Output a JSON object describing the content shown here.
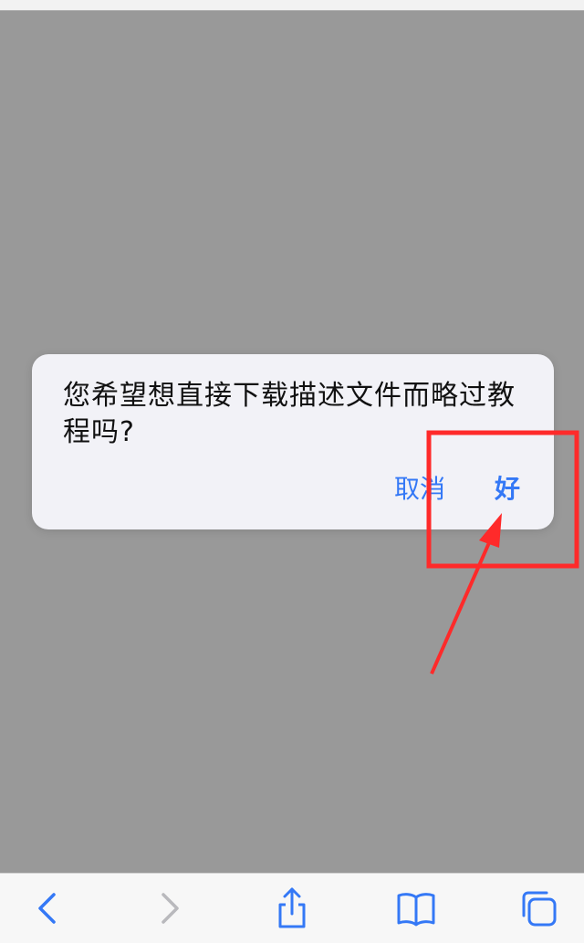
{
  "dialog": {
    "message": "您希望想直接下载描述文件而略过教程吗?",
    "cancel_label": "取消",
    "ok_label": "好"
  },
  "toolbar": {
    "items": [
      {
        "icon": "chevron-left-icon",
        "enabled": true
      },
      {
        "icon": "chevron-right-icon",
        "enabled": false
      },
      {
        "icon": "share-icon",
        "enabled": true
      },
      {
        "icon": "bookmarks-icon",
        "enabled": true
      },
      {
        "icon": "tabs-icon",
        "enabled": true
      }
    ]
  },
  "colors": {
    "accent": "#3478f6",
    "disabled": "#b9b9bd",
    "overlay": "#999999",
    "dialog_bg": "#f2f2f7",
    "annotation": "#ff2a2a"
  }
}
